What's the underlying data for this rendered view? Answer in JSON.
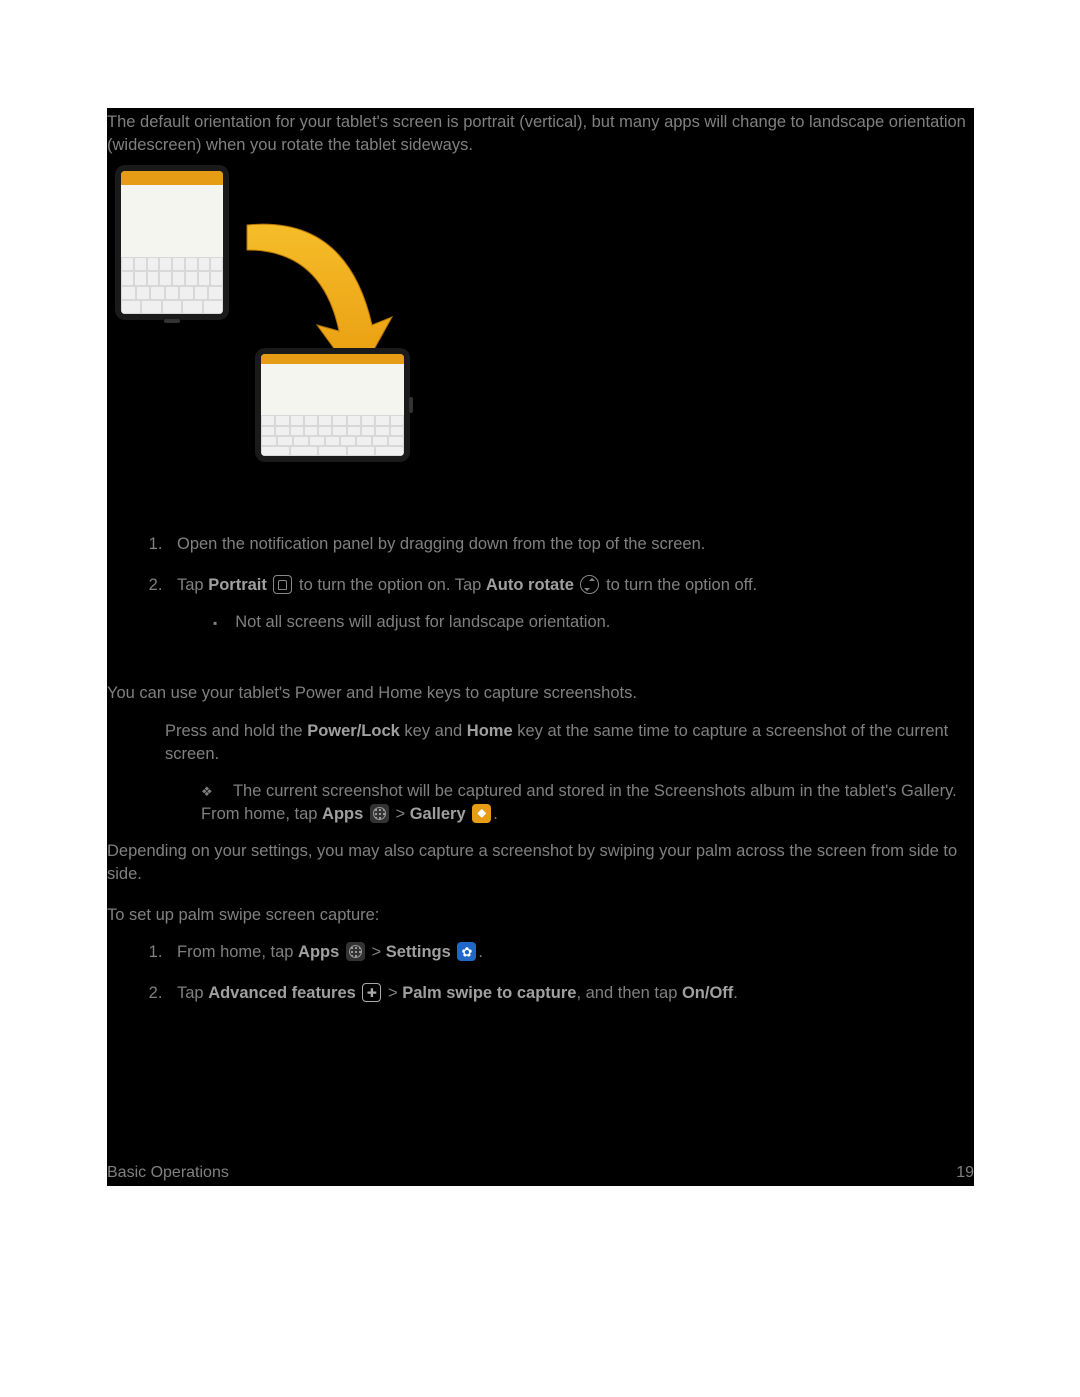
{
  "intro": {
    "p1": "The default orientation for your tablet's screen is portrait (vertical), but many apps will change to landscape orientation (widescreen) when you rotate the tablet sideways."
  },
  "steps1": {
    "item1": "Open the notification panel by dragging down from the top of the screen.",
    "item2": {
      "pre": "Tap ",
      "bold1": "Portrait",
      "mid1": " to turn the option on. Tap ",
      "bold2": "Auto rotate",
      "mid2": " to turn the option off.",
      "note": "Not all screens will adjust for landscape orientation."
    }
  },
  "capture": {
    "intro": "You can use your tablet's Power and Home keys to capture screenshots.",
    "bullet1": {
      "pre": "Press and hold the ",
      "b1": "Power/Lock",
      "mid1": " key and ",
      "b2": "Home",
      "mid2": " key at the same time to capture a screenshot of the current screen."
    },
    "sub1": {
      "pre": "The current screenshot will be captured and stored in the Screenshots album in the tablet's Gallery. From home, tap ",
      "b1": "Apps",
      "mid1": " > ",
      "b2": "Gallery",
      "post": "."
    },
    "palm_intro": "Depending on your settings, you may also capture a screenshot by swiping your palm across the screen from side to side.",
    "setup_intro": "To set up palm swipe screen capture:"
  },
  "steps2": {
    "item1": {
      "pre": "From home, tap ",
      "b1": "Apps",
      "mid1": " > ",
      "b2": "Settings",
      "post": "."
    },
    "item2": {
      "pre": "Tap ",
      "b1": "Advanced features",
      "mid1": " > ",
      "b2": "Palm swipe to capture",
      "mid2": ", and then tap ",
      "b3": "On/Off",
      "post": "."
    }
  },
  "footer": {
    "section": "Basic Operations",
    "page": "19"
  }
}
